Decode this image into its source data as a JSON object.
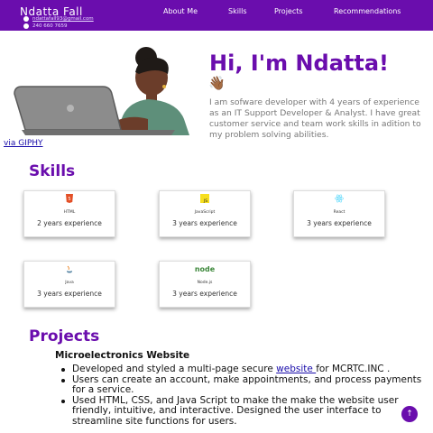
{
  "header": {
    "brand": "Ndatta Fall",
    "email": "ndattafall93@gmail.com",
    "phone": "240 660 7659",
    "nav": [
      "About Me",
      "Skills",
      "Projects",
      "Recommendations"
    ]
  },
  "hero": {
    "title": "Hi, I'm Ndatta!",
    "wave": "👋🏾",
    "text": "I am sofware developer with 4 years of experience as an IT Support Developer & Analyst. I have great customer service and team work skills in adition to my problem solving abilities.",
    "giphy_link": "via GIPHY"
  },
  "skills": {
    "title": "Skills",
    "cards": [
      {
        "name": "HTML",
        "experience": "2 years experience",
        "icon": "html5-icon"
      },
      {
        "name": "JavaScript",
        "experience": "3 years experience",
        "icon": "javascript-icon"
      },
      {
        "name": "React",
        "experience": "3 years experience",
        "icon": "react-icon"
      },
      {
        "name": "Java",
        "experience": "3 years experience",
        "icon": "java-icon"
      },
      {
        "name": "Node.js",
        "experience": "3 years experience",
        "icon": "nodejs-icon"
      }
    ]
  },
  "projects": {
    "title": "Projects",
    "name": "Microelectronics Website",
    "bullet1_pre": "Developed and styled a multi-page secure ",
    "bullet1_link": "website ",
    "bullet1_post": "for MCRTC.INC .",
    "bullet2": "Users can create an account, make appointments, and process payments for a service.",
    "bullet3": "Used HTML, CSS, and Java Script to make the make the website user friendly, intuitive, and interactive. Designed the user interface to streamline site functions for users."
  },
  "back_to_top": "↑",
  "colors": {
    "accent": "#6a0dad",
    "link": "#1a0dab"
  }
}
